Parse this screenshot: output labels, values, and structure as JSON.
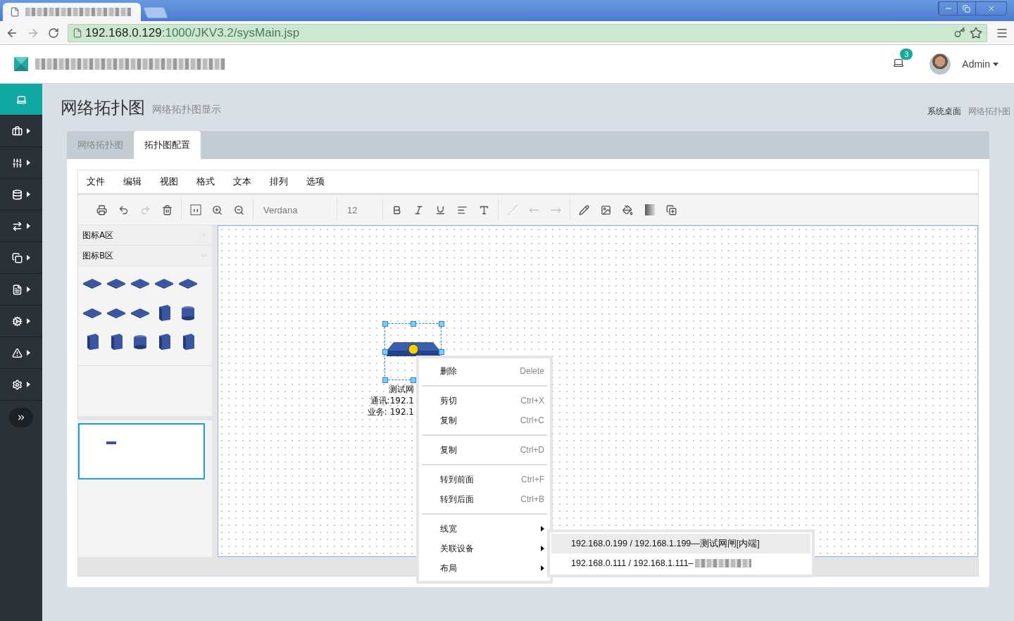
{
  "browser": {
    "address": {
      "host": "192.168.0.129",
      "path": ":1000/JKV3.2/sysMain.jsp"
    }
  },
  "header": {
    "notification_count": "3",
    "user": "Admin"
  },
  "sidebar": {
    "items": [
      {
        "selected": true,
        "submenu": false
      },
      {
        "selected": false,
        "submenu": true
      },
      {
        "selected": false,
        "submenu": true
      },
      {
        "selected": false,
        "submenu": true
      },
      {
        "selected": false,
        "submenu": true
      },
      {
        "selected": false,
        "submenu": true
      },
      {
        "selected": false,
        "submenu": true
      },
      {
        "selected": false,
        "submenu": true
      },
      {
        "selected": false,
        "submenu": true
      },
      {
        "selected": false,
        "submenu": true
      }
    ]
  },
  "page": {
    "title": "网络拓扑图",
    "subtitle": "网络拓扑图显示",
    "breadcrumbs": [
      "系统桌面",
      "网络拓扑图"
    ]
  },
  "tabs": [
    {
      "label": "网络拓扑图",
      "selected": false
    },
    {
      "label": "拓扑图配置",
      "selected": true
    }
  ],
  "editor": {
    "menu": [
      "文件",
      "编辑",
      "视图",
      "格式",
      "文本",
      "排列",
      "选项"
    ],
    "toolbar": [
      {
        "kind": "print",
        "disabled": false
      },
      {
        "kind": "undo",
        "disabled": false
      },
      {
        "kind": "redo",
        "disabled": true
      },
      {
        "kind": "delete",
        "disabled": false
      },
      {
        "kind": "sep"
      },
      {
        "kind": "actual",
        "disabled": false
      },
      {
        "kind": "zoomin",
        "disabled": false
      },
      {
        "kind": "zoomout",
        "disabled": false
      },
      {
        "kind": "sep"
      },
      {
        "kind": "font",
        "value": "Verdana"
      },
      {
        "kind": "sep"
      },
      {
        "kind": "size",
        "value": "12"
      },
      {
        "kind": "sep"
      },
      {
        "kind": "bold",
        "disabled": false
      },
      {
        "kind": "italic",
        "disabled": false
      },
      {
        "kind": "underline",
        "disabled": false
      },
      {
        "kind": "align",
        "disabled": false
      },
      {
        "kind": "fontcolor",
        "disabled": false
      },
      {
        "kind": "sep"
      },
      {
        "kind": "line",
        "disabled": true
      },
      {
        "kind": "back",
        "disabled": true
      },
      {
        "kind": "forward",
        "disabled": true
      },
      {
        "kind": "sep"
      },
      {
        "kind": "pen",
        "disabled": false
      },
      {
        "kind": "image",
        "disabled": false
      },
      {
        "kind": "fill",
        "disabled": false
      },
      {
        "kind": "gradient",
        "disabled": false
      },
      {
        "kind": "shadow",
        "disabled": false
      }
    ],
    "palette": [
      {
        "label": "图标A区",
        "expanded": false
      },
      {
        "label": "图标B区",
        "expanded": true
      }
    ],
    "node": {
      "selected": true,
      "label_lines": [
        "测试网",
        "通讯:192.1",
        "业务: 192.1"
      ]
    },
    "context_menu": {
      "groups": [
        [
          {
            "label": "删除",
            "shortcut": "Delete"
          }
        ],
        [
          {
            "label": "剪切",
            "shortcut": "Ctrl+X"
          },
          {
            "label": "复制",
            "shortcut": "Ctrl+C"
          }
        ],
        [
          {
            "label": "复制",
            "shortcut": "Ctrl+D"
          }
        ],
        [
          {
            "label": "转到前面",
            "shortcut": "Ctrl+F"
          },
          {
            "label": "转到后面",
            "shortcut": "Ctrl+B"
          }
        ],
        [
          {
            "label": "线宽",
            "submenu": true
          },
          {
            "label": "关联设备",
            "submenu": true
          },
          {
            "label": "布局",
            "submenu": true
          }
        ]
      ],
      "submenu": [
        {
          "label": "192.168.0.199 / 192.168.1.199—测试网闸[内端]",
          "selected": true
        },
        {
          "label": "192.168.0.111 / 192.168.1.111–",
          "selected": false
        }
      ]
    }
  }
}
